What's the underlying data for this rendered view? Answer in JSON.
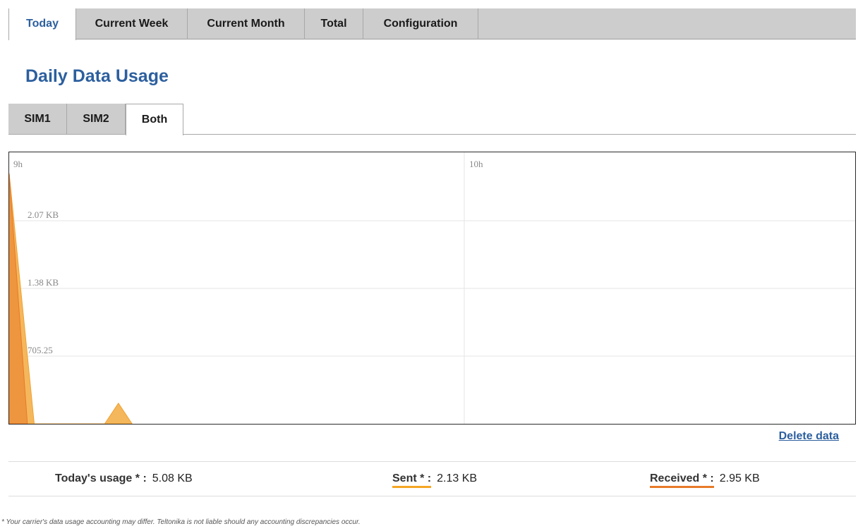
{
  "tabs": [
    {
      "label": "Today",
      "active": true
    },
    {
      "label": "Current Week",
      "active": false
    },
    {
      "label": "Current Month",
      "active": false
    },
    {
      "label": "Total",
      "active": false
    },
    {
      "label": "Configuration",
      "active": false
    }
  ],
  "page_title": "Daily Data Usage",
  "sim_tabs": [
    {
      "label": "SIM1",
      "active": false
    },
    {
      "label": "SIM2",
      "active": false
    },
    {
      "label": "Both",
      "active": true
    }
  ],
  "chart_data": {
    "type": "area",
    "x_ticks": [
      "9h",
      "10h"
    ],
    "y_ticks": [
      "2.07 KB",
      "1.38 KB",
      "705.25"
    ],
    "series": [
      {
        "name": "Sent",
        "color": "#f5b75c",
        "points": [
          [
            0,
            2.55
          ],
          [
            0.055,
            0
          ],
          [
            0.21,
            0
          ],
          [
            0.24,
            0.21
          ],
          [
            0.27,
            0
          ]
        ]
      },
      {
        "name": "Received",
        "color": "#e87a28",
        "points": [
          [
            0,
            2.55
          ],
          [
            0.04,
            0
          ]
        ]
      }
    ],
    "grid": true
  },
  "delete_label": "Delete data",
  "stats": {
    "today_label": "Today's usage * :",
    "today_value": "5.08 KB",
    "sent_label": "Sent * :",
    "sent_value": "2.13 KB",
    "received_label": "Received * :",
    "received_value": "2.95 KB"
  },
  "footnote": "* Your carrier's data usage accounting may differ. Teltonika is not liable should any accounting discrepancies occur.",
  "colors": {
    "accent": "#2c5f9e",
    "sent": "#f5a623",
    "received": "#e87a28"
  }
}
